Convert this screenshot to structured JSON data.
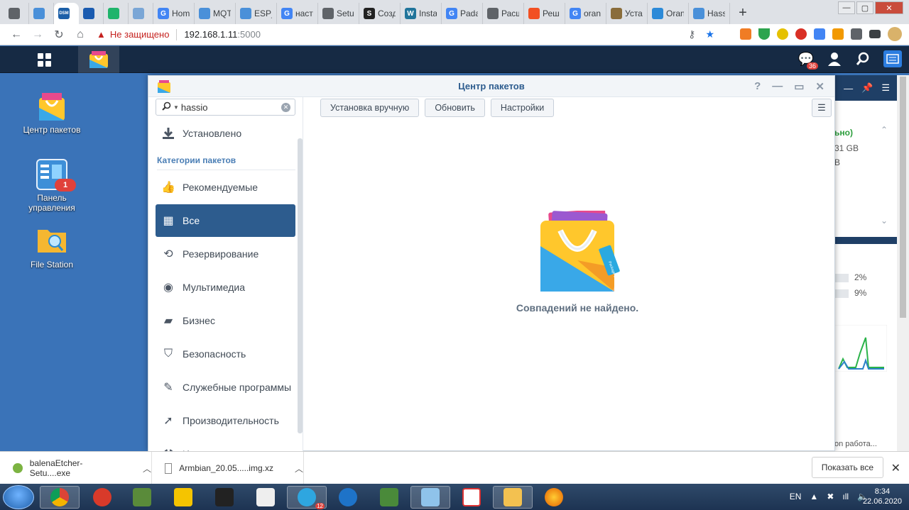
{
  "browser": {
    "tabs": [
      {
        "label": "",
        "icon": "speaker-icon",
        "color": "#5f6368"
      },
      {
        "label": "",
        "icon": "synology-icon",
        "color": "#4a90d9"
      },
      {
        "label": "",
        "icon": "dsm-icon",
        "color": "#1c5fa8",
        "fav_text": "DSM"
      },
      {
        "label": "",
        "icon": "onepassword-icon",
        "color": "#1a5bb0"
      },
      {
        "label": "",
        "icon": "green-dot-icon",
        "color": "#1fb46b"
      },
      {
        "label": "",
        "icon": "gauge-icon",
        "color": "#7aa6d6"
      },
      {
        "label": "Hom",
        "icon": "google-icon",
        "color": "#4285f4",
        "fav_text": "G"
      },
      {
        "label": "MQT",
        "icon": "synology-icon",
        "color": "#4a90d9"
      },
      {
        "label": "ESP_",
        "icon": "synology-icon",
        "color": "#4a90d9"
      },
      {
        "label": "наст",
        "icon": "google-icon",
        "color": "#4285f4",
        "fav_text": "G"
      },
      {
        "label": "Setu",
        "icon": "globe-icon",
        "color": "#5f6368"
      },
      {
        "label": "Созд",
        "icon": "s-icon",
        "color": "#222222",
        "fav_text": "S"
      },
      {
        "label": "Insta",
        "icon": "wordpress-icon",
        "color": "#21759b",
        "fav_text": "W"
      },
      {
        "label": "Pada",
        "icon": "google-icon",
        "color": "#4285f4",
        "fav_text": "G"
      },
      {
        "label": "Расш",
        "icon": "globe-icon",
        "color": "#5f6368"
      },
      {
        "label": "Реш",
        "icon": "microsoft-icon",
        "color": "#f25022"
      },
      {
        "label": "oran",
        "icon": "google-icon",
        "color": "#4285f4",
        "fav_text": "G"
      },
      {
        "label": "Уста",
        "icon": "gear-icon",
        "color": "#8a6d3b"
      },
      {
        "label": "Oran",
        "icon": "wifi-icon",
        "color": "#2c8ad8"
      },
      {
        "label": "Hass",
        "icon": "synology-icon",
        "color": "#4a90d9"
      }
    ],
    "window_controls": [
      "—",
      "▢",
      "✕"
    ],
    "address": {
      "warning": "Не защищено",
      "host": "192.168.1.11",
      "port": ":5000"
    }
  },
  "dsm": {
    "chat_badge": "36",
    "desktop_icons": [
      {
        "label": "Центр пакетов",
        "icon": "package-center-icon"
      },
      {
        "label": "Панель управления",
        "icon": "control-panel-icon",
        "badge": "1"
      },
      {
        "label": "File Station",
        "icon": "file-station-icon"
      }
    ],
    "right_widget": {
      "line1": "ьно)",
      "line2": "31 GB",
      "line3": "B",
      "pct1": "2%",
      "pct2": "9%",
      "footer": "on работа..."
    }
  },
  "window": {
    "title": "Центр пакетов",
    "controls": [
      "?",
      "—",
      "▭",
      "✕"
    ],
    "search": {
      "value": "hassio"
    },
    "installed_label": "Установлено",
    "categories_header": "Категории пакетов",
    "categories": [
      {
        "label": "Рекомендуемые",
        "icon": "thumbs-up-icon"
      },
      {
        "label": "Все",
        "icon": "grid-icon",
        "selected": true
      },
      {
        "label": "Резервирование",
        "icon": "backup-icon"
      },
      {
        "label": "Мультимедиа",
        "icon": "film-reel-icon"
      },
      {
        "label": "Бизнес",
        "icon": "briefcase-icon"
      },
      {
        "label": "Безопасность",
        "icon": "shield-icon"
      },
      {
        "label": "Служебные программы",
        "icon": "wrench-icon"
      },
      {
        "label": "Производительность",
        "icon": "rocket-icon"
      },
      {
        "label": "Инструменты",
        "icon": "tools-icon"
      }
    ],
    "toolbar": {
      "manual_install": "Установка вручную",
      "refresh": "Обновить",
      "settings": "Настройки"
    },
    "empty_message": "Совпадений не найдено.",
    "bag_tag": "Package Center"
  },
  "downloads": {
    "items": [
      {
        "name": "balenaEtcher-Setu....exe"
      },
      {
        "name": "Armbian_20.05.....img.xz"
      }
    ],
    "show_all": "Показать все"
  },
  "taskbar": {
    "language": "EN",
    "time": "8:34",
    "date": "22.06.2020",
    "telegram_badge": "12"
  }
}
